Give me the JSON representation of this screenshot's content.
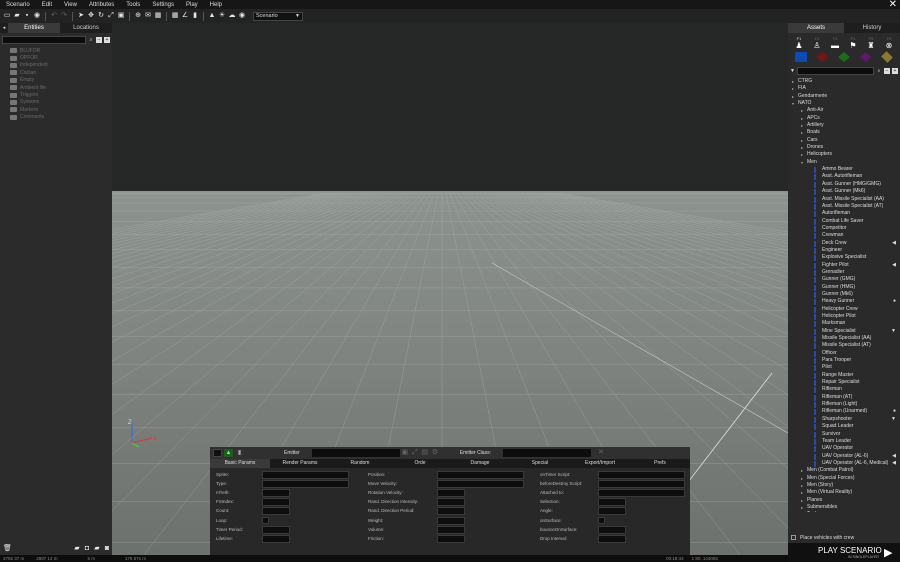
{
  "menu": [
    "Scenario",
    "Edit",
    "View",
    "Attributes",
    "Tools",
    "Settings",
    "Play",
    "Help"
  ],
  "toolbar": {
    "scenario_dropdown": "Scenario"
  },
  "left_panel": {
    "tabs": [
      "Entities",
      "Locations"
    ],
    "folders": [
      "BLUFOR",
      "OPFOR",
      "Independent",
      "Civilian",
      "Empty",
      "Ambient life",
      "Triggers",
      "Systems",
      "Markers",
      "Comments"
    ]
  },
  "right_panel": {
    "tabs": [
      "Assets",
      "History"
    ],
    "side_keys": [
      "F1",
      "F2",
      "F3",
      "F4",
      "F5",
      "F6"
    ],
    "side_colors": [
      "#0a4bb8",
      "#7a1414",
      "#1c6d1c",
      "#5b1a6b",
      "#8a7a2a"
    ],
    "tree": [
      {
        "label": "CTRG",
        "depth": 0,
        "arrow": "▸"
      },
      {
        "label": "FIA",
        "depth": 0,
        "arrow": "▸"
      },
      {
        "label": "Gendarmerie",
        "depth": 0,
        "arrow": "▸"
      },
      {
        "label": "NATO",
        "depth": 0,
        "arrow": "▾"
      },
      {
        "label": "Anti-Air",
        "depth": 1,
        "arrow": "▸"
      },
      {
        "label": "APCs",
        "depth": 1,
        "arrow": "▸"
      },
      {
        "label": "Artillery",
        "depth": 1,
        "arrow": "▸"
      },
      {
        "label": "Boats",
        "depth": 1,
        "arrow": "▸"
      },
      {
        "label": "Cars",
        "depth": 1,
        "arrow": "▸"
      },
      {
        "label": "Drones",
        "depth": 1,
        "arrow": "▸"
      },
      {
        "label": "Helicopters",
        "depth": 1,
        "arrow": "▸"
      },
      {
        "label": "Men",
        "depth": 1,
        "arrow": "▾"
      },
      {
        "label": "Ammo Bearer",
        "depth": 2
      },
      {
        "label": "Asst. Autorifleman",
        "depth": 2
      },
      {
        "label": "Asst. Gunner (HMG/GMG)",
        "depth": 2
      },
      {
        "label": "Asst. Gunner (Mk6)",
        "depth": 2
      },
      {
        "label": "Asst. Missile Specialist (AA)",
        "depth": 2
      },
      {
        "label": "Asst. Missile Specialist (AT)",
        "depth": 2
      },
      {
        "label": "Autorifleman",
        "depth": 2
      },
      {
        "label": "Combat Life Saver",
        "depth": 2
      },
      {
        "label": "Competitor",
        "depth": 2
      },
      {
        "label": "Crewman",
        "depth": 2
      },
      {
        "label": "Deck Crew",
        "depth": 2,
        "icon": "◀"
      },
      {
        "label": "Engineer",
        "depth": 2
      },
      {
        "label": "Explosive Specialist",
        "depth": 2
      },
      {
        "label": "Fighter Pilot",
        "depth": 2,
        "icon": "◀"
      },
      {
        "label": "Grenadier",
        "depth": 2
      },
      {
        "label": "Gunner (GMG)",
        "depth": 2
      },
      {
        "label": "Gunner (HMG)",
        "depth": 2
      },
      {
        "label": "Gunner (Mk6)",
        "depth": 2
      },
      {
        "label": "Heavy Gunner",
        "depth": 2,
        "icon": "●"
      },
      {
        "label": "Helicopter Crew",
        "depth": 2
      },
      {
        "label": "Helicopter Pilot",
        "depth": 2
      },
      {
        "label": "Marksman",
        "depth": 2
      },
      {
        "label": "Mine Specialist",
        "depth": 2,
        "icon": "▼"
      },
      {
        "label": "Missile Specialist (AA)",
        "depth": 2
      },
      {
        "label": "Missile Specialist (AT)",
        "depth": 2
      },
      {
        "label": "Officer",
        "depth": 2
      },
      {
        "label": "Para Trooper",
        "depth": 2
      },
      {
        "label": "Pilot",
        "depth": 2
      },
      {
        "label": "Range Master",
        "depth": 2
      },
      {
        "label": "Repair Specialist",
        "depth": 2
      },
      {
        "label": "Rifleman",
        "depth": 2
      },
      {
        "label": "Rifleman (AT)",
        "depth": 2
      },
      {
        "label": "Rifleman (Light)",
        "depth": 2
      },
      {
        "label": "Rifleman (Unarmed)",
        "depth": 2,
        "icon": "●"
      },
      {
        "label": "Sharpshooter",
        "depth": 2,
        "icon": "▼"
      },
      {
        "label": "Squad Leader",
        "depth": 2
      },
      {
        "label": "Survivor",
        "depth": 2
      },
      {
        "label": "Team Leader",
        "depth": 2
      },
      {
        "label": "UAV Operator",
        "depth": 2
      },
      {
        "label": "UAV Operator (AL-6)",
        "depth": 2,
        "icon": "◀"
      },
      {
        "label": "UAV Operator (AL-6, Medical)",
        "depth": 2,
        "icon": "◀"
      },
      {
        "label": "Men (Combat Patrol)",
        "depth": 1,
        "arrow": "▸"
      },
      {
        "label": "Men (Special Forces)",
        "depth": 1,
        "arrow": "▸"
      },
      {
        "label": "Men (Story)",
        "depth": 1,
        "arrow": "▸"
      },
      {
        "label": "Men (Virtual Reality)",
        "depth": 1,
        "arrow": "▸"
      },
      {
        "label": "Planes",
        "depth": 1,
        "arrow": "▸"
      },
      {
        "label": "Submersibles",
        "depth": 1,
        "arrow": "▸"
      },
      {
        "label": "Tanks",
        "depth": 1,
        "arrow": "▸"
      }
    ],
    "place_with_crew": "Place vehicles with crew"
  },
  "play": {
    "label": "PLAY SCENARIO",
    "sub": "IN SINGLEPLAYER"
  },
  "emitter": {
    "emitter_label": "Emitter",
    "class_label": "Emitter Class:",
    "tabs": [
      "Basic Params",
      "Render Params",
      "Random",
      "Orde",
      "Damage",
      "Special",
      "Export/Import",
      "Prefs"
    ],
    "col1": [
      "Sprite:",
      "Type:",
      "nTieth:",
      "FSIndex:",
      "Count:",
      "Loop:",
      "Timer Period:",
      "Lifetime:"
    ],
    "col2": [
      "Position:",
      "Move Velocity:",
      "Rotation Velocity:",
      "Rand. Direction Intensity:",
      "Rand. Direction Period:",
      "Weight:",
      "Volume:",
      "Friction:"
    ],
    "col3": [
      "onTimer Script:",
      "beforeDestroy Script:",
      "Attached to:",
      "Selection:",
      "Angle:",
      "onSurface:",
      "bounceOnSurface:",
      "Drop Interval:"
    ]
  },
  "status": {
    "pos1": "2755 37 m",
    "pos2": "2887 14 m",
    "pos3": "5 m",
    "fov": "176 57s m",
    "time": "00:18:44",
    "date": "1 80. 144065"
  },
  "axes": {
    "z": "Z",
    "x": "X"
  },
  "colors": {
    "viewport_fog": "#8d9490",
    "ground": "#6e716e",
    "accent": "#2c4aa8"
  }
}
